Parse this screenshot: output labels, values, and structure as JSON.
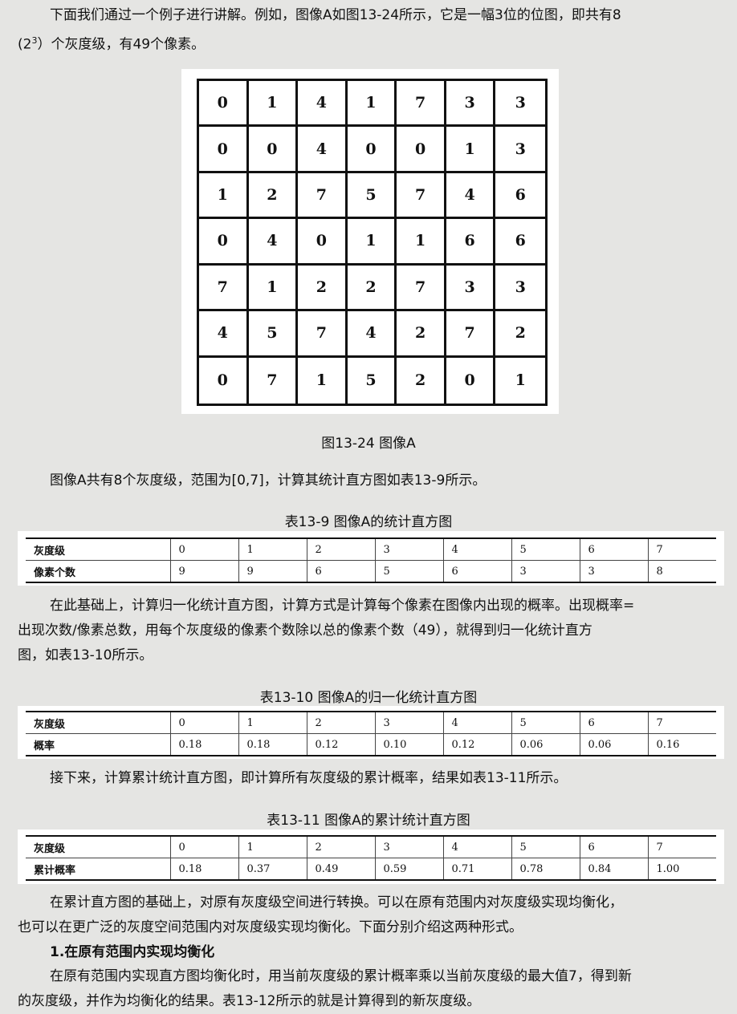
{
  "intro": {
    "line1": "下面我们通过一个例子进行讲解。例如，图像A如图13-24所示，它是一幅3位的位图，即共有8",
    "line2_prefix": "(2",
    "line2_sup": "3",
    "line2_suffix": "）个灰度级，有49个像素。"
  },
  "figure": {
    "caption": "图13-24 图像A",
    "matrix": [
      [
        "0",
        "1",
        "4",
        "1",
        "7",
        "3",
        "3"
      ],
      [
        "0",
        "0",
        "4",
        "0",
        "0",
        "1",
        "3"
      ],
      [
        "1",
        "2",
        "7",
        "5",
        "7",
        "4",
        "6"
      ],
      [
        "0",
        "4",
        "0",
        "1",
        "1",
        "6",
        "6"
      ],
      [
        "7",
        "1",
        "2",
        "2",
        "7",
        "3",
        "3"
      ],
      [
        "4",
        "5",
        "7",
        "4",
        "2",
        "7",
        "2"
      ],
      [
        "0",
        "7",
        "1",
        "5",
        "2",
        "0",
        "1"
      ]
    ]
  },
  "para_histogram": "图像A共有8个灰度级，范围为[0,7]，计算其统计直方图如表13-9所示。",
  "table1": {
    "title": "表13-9 图像A的统计直方图",
    "rows": [
      [
        "灰度级",
        "0",
        "1",
        "2",
        "3",
        "4",
        "5",
        "6",
        "7"
      ],
      [
        "像素个数",
        "9",
        "9",
        "6",
        "5",
        "6",
        "3",
        "3",
        "8"
      ]
    ]
  },
  "para_normalized": {
    "line1": "在此基础上，计算归一化统计直方图，计算方式是计算每个像素在图像内出现的概率。出现概率=",
    "line2": "出现次数/像素总数，用每个灰度级的像素个数除以总的像素个数（49），就得到归一化统计直方",
    "line3": "图，如表13-10所示。"
  },
  "table2": {
    "title": "表13-10 图像A的归一化统计直方图",
    "rows": [
      [
        "灰度级",
        "0",
        "1",
        "2",
        "3",
        "4",
        "5",
        "6",
        "7"
      ],
      [
        "概率",
        "0.18",
        "0.18",
        "0.12",
        "0.10",
        "0.12",
        "0.06",
        "0.06",
        "0.16"
      ]
    ]
  },
  "para_cumulative": "接下来，计算累计统计直方图，即计算所有灰度级的累计概率，结果如表13-11所示。",
  "table3": {
    "title": "表13-11 图像A的累计统计直方图",
    "rows": [
      [
        "灰度级",
        "0",
        "1",
        "2",
        "3",
        "4",
        "5",
        "6",
        "7"
      ],
      [
        "累计概率",
        "0.18",
        "0.37",
        "0.49",
        "0.59",
        "0.71",
        "0.78",
        "0.84",
        "1.00"
      ]
    ]
  },
  "para_transform": {
    "line1": "在累计直方图的基础上，对原有灰度级空间进行转换。可以在原有范围内对灰度级实现均衡化，",
    "line2": "也可以在更广泛的灰度空间范围内对灰度级实现均衡化。下面分别介绍这两种形式。"
  },
  "heading": "1.在原有范围内实现均衡化",
  "para_final": {
    "line1": "在原有范围内实现直方图均衡化时，用当前灰度级的累计概率乘以当前灰度级的最大值7，得到新",
    "line2": "的灰度级，并作为均衡化的结果。表13-12所示的就是计算得到的新灰度级。"
  }
}
